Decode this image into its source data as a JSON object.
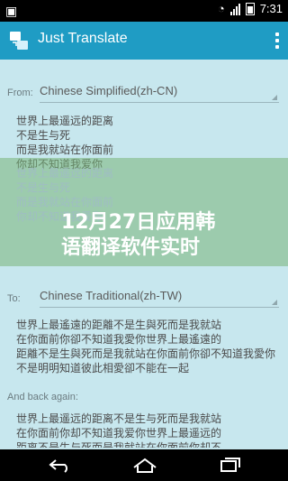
{
  "status": {
    "time": "7:31"
  },
  "app": {
    "title": "Just Translate"
  },
  "from": {
    "label": "From:",
    "language": "Chinese Simplified(zh-CN)"
  },
  "source_text": "世界上最遥远的距离\n不是生与死\n而是我就站在你面前\n你却不知道我爱你",
  "overlay_faded_text": "世界上最遥远的距离\n不是生与死\n而是我就站在你面前\n你却不知道我爱你",
  "banner": {
    "line1": "12月27日应用韩",
    "line2": "语翻译软件实时"
  },
  "to": {
    "label": "To:",
    "language": "Chinese Traditional(zh-TW)"
  },
  "translated_text": "世界上最遙遠的距離不是生與死而是我就站\n在你面前你卻不知道我愛你世界上最遙遠的\n距離不是生與死而是我就站在你面前你卻不知道我愛你\n不是明明知道彼此相愛卻不能在一起",
  "back": {
    "label": "And back again:"
  },
  "back_text": "世界上最遥远的距离不是生与死而是我就站\n在你面前你却不知道我爱你世界上最遥远的\n距离不是生与死而是我就站在你面前你却不"
}
